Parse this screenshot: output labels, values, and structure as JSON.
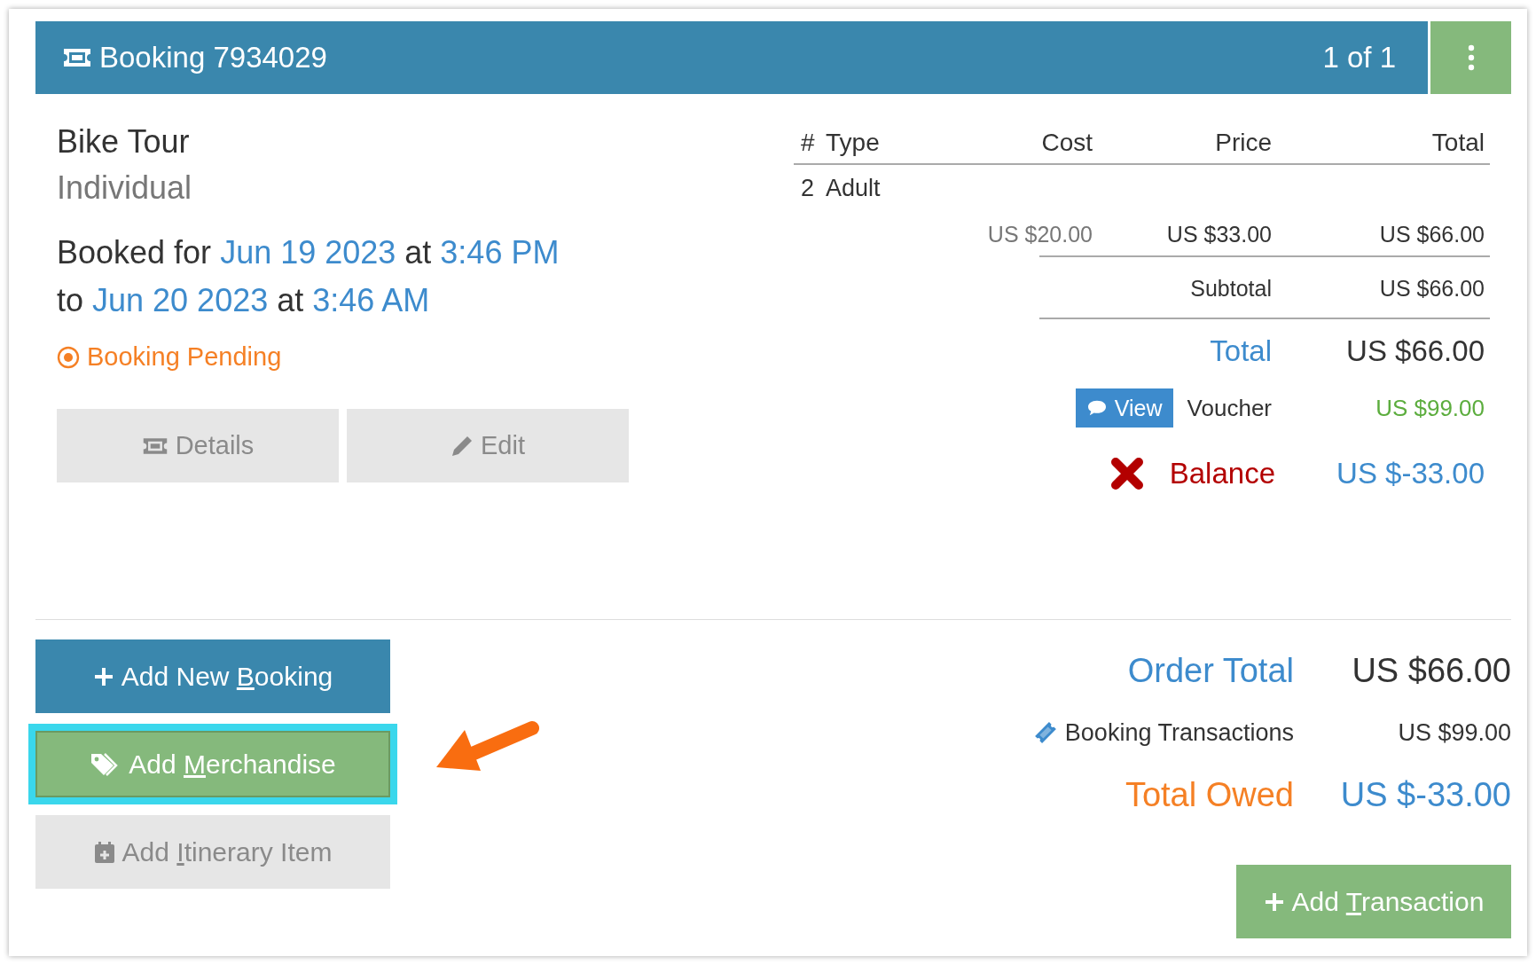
{
  "header": {
    "title": "Booking 7934029",
    "pager": "1 of 1"
  },
  "booking": {
    "name": "Bike Tour",
    "category": "Individual",
    "schedule": {
      "prefix": "Booked for",
      "start_date": "Jun 19 2023",
      "start_at": "at",
      "start_time": "3:46 PM",
      "joiner": "to",
      "end_date": "Jun 20 2023",
      "end_at": "at",
      "end_time": "3:46 AM"
    },
    "status": "Booking Pending",
    "actions": [
      {
        "label": "Details"
      },
      {
        "label": "Edit"
      }
    ]
  },
  "price_table": {
    "columns": [
      "#",
      "Type",
      "Cost",
      "Price",
      "Total"
    ],
    "items": [
      {
        "qty": "2",
        "type": "Adult",
        "cost": "US $20.00",
        "price": "US $33.00",
        "total": "US $66.00"
      }
    ],
    "subtotal": {
      "label": "Subtotal",
      "value": "US $66.00"
    },
    "total": {
      "label": "Total",
      "value": "US $66.00"
    },
    "voucher": {
      "button": "View",
      "label": "Voucher",
      "value": "US $99.00"
    },
    "balance": {
      "label": "Balance",
      "value": "US $-33.00",
      "paid": false
    }
  },
  "add_buttons": [
    {
      "kind": "primary",
      "parts": [
        "Add New ",
        "B",
        "ooking"
      ],
      "highlighted": false
    },
    {
      "kind": "success",
      "parts": [
        "Add ",
        "M",
        "erchandise"
      ],
      "highlighted": true
    },
    {
      "kind": "default",
      "parts": [
        "Add ",
        "I",
        "tinerary Item"
      ],
      "highlighted": false
    }
  ],
  "order_summary": {
    "order_total": {
      "label": "Order Total",
      "value": "US $66.00"
    },
    "transactions": {
      "label": "Booking Transactions",
      "value": "US $99.00"
    },
    "total_owed": {
      "label": "Total Owed",
      "value": "US $-33.00"
    }
  },
  "add_transaction": {
    "parts": [
      "Add ",
      "T",
      "ransaction"
    ]
  }
}
